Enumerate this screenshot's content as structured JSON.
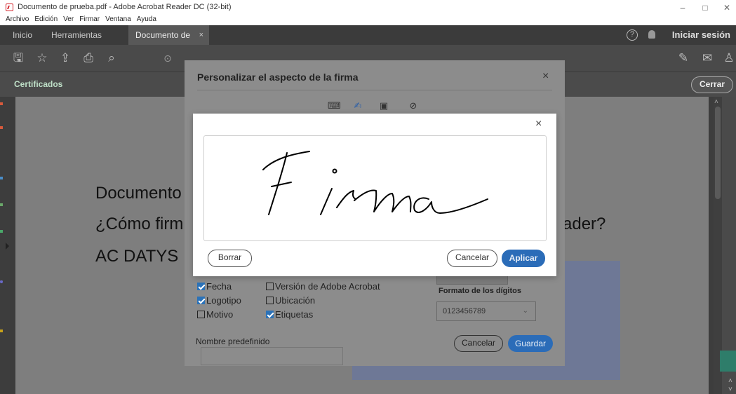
{
  "window": {
    "title": "Documento de prueba.pdf - Adobe Acrobat Reader DC (32-bit)",
    "minimize": "–",
    "restore": "□",
    "close": "✕"
  },
  "menu": [
    "Archivo",
    "Edición",
    "Ver",
    "Firmar",
    "Ventana",
    "Ayuda"
  ],
  "tabs": {
    "home": "Inicio",
    "tools": "Herramientas",
    "document": "Documento de pru...",
    "document_close": "×",
    "help_icon": "?",
    "login": "Iniciar sesión"
  },
  "certbar": {
    "label": "Certificados",
    "close": "Cerrar"
  },
  "document": {
    "line1": "Documento",
    "line2": "¿Cómo firm",
    "line2_end": "ader?",
    "line3": "AC DATYS"
  },
  "customize_dialog": {
    "title": "Personalizar el aspecto de la firma",
    "close": "×",
    "checkboxes": [
      {
        "label": "Fecha",
        "checked": true
      },
      {
        "label": "Versión de Adobe Acrobat",
        "checked": false
      },
      {
        "label": "Logotipo",
        "checked": true
      },
      {
        "label": "Ubicación",
        "checked": false
      },
      {
        "label": "Motivo",
        "checked": false
      },
      {
        "label": "Etiquetas",
        "checked": true
      }
    ],
    "digits_format_label": "Formato de los dígitos",
    "digits_format_value": "0123456789",
    "default_name_label": "Nombre predefinido",
    "cancel": "Cancelar",
    "save": "Guardar"
  },
  "signature_dialog": {
    "close": "×",
    "clear": "Borrar",
    "cancel": "Cancelar",
    "apply": "Aplicar",
    "signature_text": "Firma"
  },
  "colors": {
    "accent_blue": "#2b72b8",
    "dark_ui": "#3b3b3b",
    "cert_label": "#bfe0c8"
  }
}
